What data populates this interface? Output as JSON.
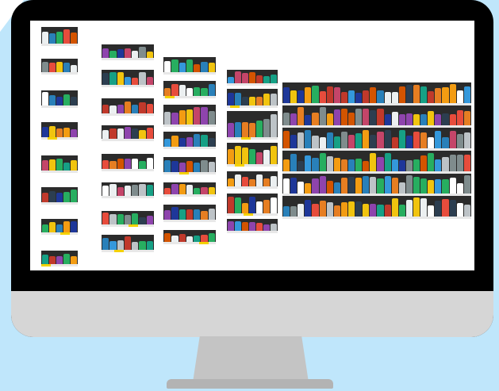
{
  "scene": {
    "description_tags": [
      "monitor-illustration",
      "store-shelf-photo"
    ],
    "colors": {
      "backdrop": "#bfe6fb",
      "bezel": "#000000",
      "chin": "#d6d6d6",
      "stand": "#c4c4c4",
      "screen": "#ffffff"
    }
  },
  "icons": [
    "monitor-icon"
  ]
}
